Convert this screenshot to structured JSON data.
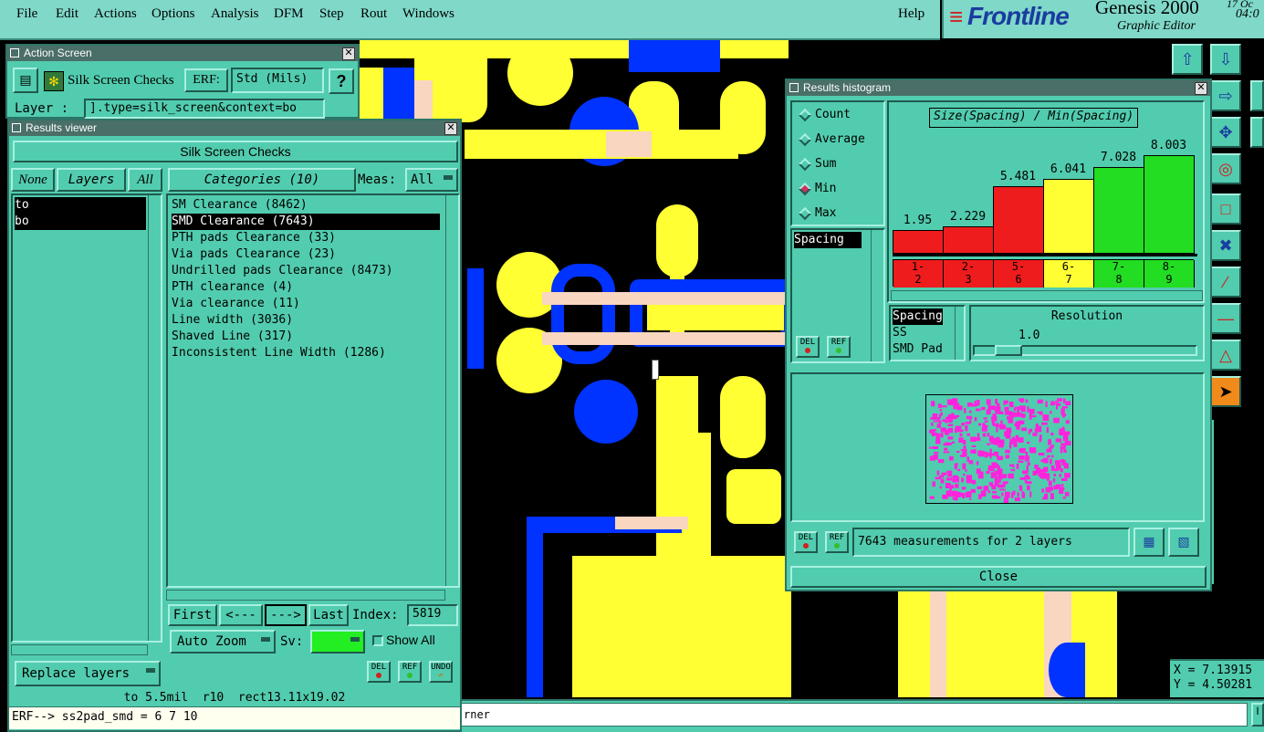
{
  "menubar": {
    "items": [
      "File",
      "Edit",
      "Actions",
      "Options",
      "Analysis",
      "DFM",
      "Step",
      "Rout",
      "Windows"
    ],
    "help": "Help"
  },
  "brand": {
    "logo": "Frontline",
    "product": "Genesis 2000",
    "subtitle": "Graphic Editor",
    "time_top": "17 Oc",
    "time_bottom": "04:0"
  },
  "action_screen": {
    "title": "Action Screen",
    "checklist_label": "Silk Screen Checks",
    "erf_label": "ERF:",
    "erf_value": "Std (Mils)",
    "help_button": "?",
    "layer_label": "Layer :",
    "layer_value": "].type=silk_screen&context=bo"
  },
  "results_viewer": {
    "title": "Results viewer",
    "header": "Silk Screen Checks",
    "none_button": "None",
    "layers_button": "Layers",
    "all_button": "All",
    "layers": [
      "to",
      "bo"
    ],
    "categories_button": "Categories (10)",
    "meas_label": "Meas:",
    "meas_value": "All",
    "categories": [
      "SM Clearance (8462)",
      "SMD Clearance (7643)",
      "PTH pads Clearance (33)",
      "Via pads Clearance (23)",
      "Undrilled pads Clearance (8473)",
      "PTH clearance (4)",
      "Via clearance (11)",
      "Line width (3036)",
      "Shaved Line (317)",
      "Inconsistent Line Width (1286)"
    ],
    "selected_category": 1,
    "first_button": "First",
    "prev_button": "<---",
    "next_button": "--->",
    "last_button": "Last",
    "index_label": "Index:",
    "index_value": "5819",
    "autozoom_label": "Auto Zoom",
    "sv_label": "Sv:",
    "show_all_label": "Show All",
    "replace_layers_label": "Replace layers",
    "del_label": "DEL",
    "ref_label": "REF",
    "undo_label": "UNDO",
    "status_line": "to 5.5mil  r10  rect13.11x19.02"
  },
  "erf_line": "ERF--> ss2pad_smd = 6 7 10",
  "bottom_status": "rner",
  "histogram": {
    "title": "Results histogram",
    "modes": [
      "Count",
      "Average",
      "Sum",
      "Min",
      "Max"
    ],
    "selected_mode": 3,
    "measure_list": [
      "Spacing"
    ],
    "chart_title": "Size(Spacing) / Min(Spacing)",
    "axis_list": [
      "Spacing",
      "SS",
      "SMD Pad"
    ],
    "resolution_label": "Resolution",
    "resolution_value": "1.0",
    "del_label": "DEL",
    "ref_label": "REF",
    "summary": "7643 measurements for 2 layers",
    "close_label": "Close",
    "colors": {
      "red": "#ee1c1c",
      "yellow": "#ffff33",
      "green": "#22dd22",
      "preview": "#ff22dd"
    }
  },
  "chart_data": {
    "type": "bar",
    "title": "Size(Spacing) / Min(Spacing)",
    "categories": [
      "1-2",
      "2-3",
      "5-6",
      "6-7",
      "7-8",
      "8-9"
    ],
    "category_labels": [
      [
        "1-",
        "2"
      ],
      [
        "2-",
        "3"
      ],
      [
        "5-",
        "6"
      ],
      [
        "6-",
        "7"
      ],
      [
        "7-",
        "8"
      ],
      [
        "8-",
        "9"
      ]
    ],
    "values": [
      1.95,
      2.229,
      5.481,
      6.041,
      7.028,
      8.003
    ],
    "value_labels": [
      "1.95",
      "2.229",
      "5.481",
      "6.041",
      "7.028",
      "8.003"
    ],
    "bar_colors": [
      "#ee1c1c",
      "#ee1c1c",
      "#ee1c1c",
      "#ffff33",
      "#22dd22",
      "#22dd22"
    ],
    "ylim": [
      0,
      8.003
    ],
    "grid": false,
    "xlabel": "",
    "ylabel": ""
  },
  "coords": {
    "x": "X = 7.13915",
    "y": "Y = 4.50281"
  }
}
